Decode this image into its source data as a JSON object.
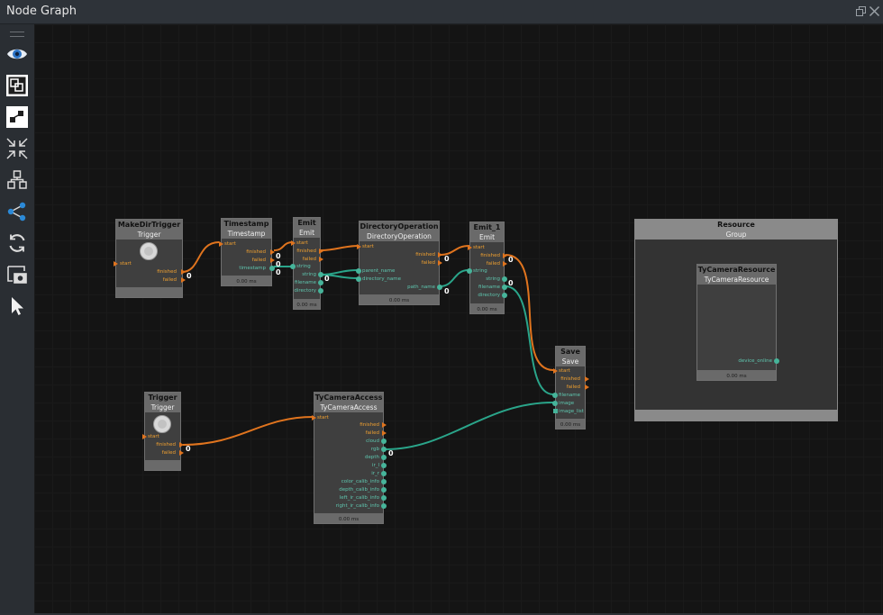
{
  "window": {
    "title": "Node Graph",
    "restore_icon": "restore-icon",
    "close_icon": "close-icon"
  },
  "toolbar": [
    "eye-icon",
    "frame-icon",
    "layout-icon",
    "collapse-icon",
    "tree-icon",
    "share-icon",
    "refresh-icon",
    "camera-icon",
    "cursor-icon"
  ],
  "colors": {
    "exec": "#e0741e",
    "data": "#2aa58a",
    "header": "#6a6a6a",
    "canvas": "#141414"
  },
  "nodes": {
    "makedir": {
      "title": "MakeDirTrigger",
      "type": "Trigger",
      "in": [
        "start"
      ],
      "out": [
        "finished",
        "failed"
      ],
      "counts": [
        "0"
      ]
    },
    "timestamp": {
      "title": "Timestamp",
      "type": "Timestamp",
      "in": [
        "start"
      ],
      "out": [
        "finished",
        "failed",
        "timestamp"
      ],
      "counts": [
        "0",
        "0",
        "0"
      ],
      "time": "0.00 ms"
    },
    "emit": {
      "title": "Emit",
      "type": "Emit",
      "in": [
        "start",
        "string"
      ],
      "out": [
        "finished",
        "failed",
        "string",
        "filename",
        "directory"
      ],
      "counts": [
        "0"
      ],
      "time": "0.00 ms"
    },
    "dirop": {
      "title": "DirectoryOperation",
      "type": "DirectoryOperation",
      "in": [
        "start",
        "parent_name",
        "directory_name"
      ],
      "out": [
        "finished",
        "failed",
        "path_name"
      ],
      "counts": [
        "0",
        "0"
      ],
      "time": "0.00 ms"
    },
    "emit1": {
      "title": "Emit_1",
      "type": "Emit",
      "in": [
        "start",
        "string"
      ],
      "out": [
        "finished",
        "failed",
        "string",
        "filename",
        "directory"
      ],
      "counts": [
        "0",
        "0"
      ],
      "time": "0.00 ms"
    },
    "save": {
      "title": "Save",
      "type": "Save",
      "in": [
        "start",
        "filename",
        "image",
        "image_list"
      ],
      "out": [
        "finished",
        "failed"
      ],
      "time": "0.00 ms"
    },
    "trigger": {
      "title": "Trigger",
      "type": "Trigger",
      "in": [
        "start"
      ],
      "out": [
        "finished",
        "failed"
      ],
      "counts": [
        "0"
      ]
    },
    "tycam": {
      "title": "TyCameraAccess",
      "type": "TyCameraAccess",
      "in": [
        "start"
      ],
      "out": [
        "finished",
        "failed",
        "cloud",
        "rgb",
        "depth",
        "ir_l",
        "ir_r",
        "color_calib_info",
        "depth_calib_info",
        "left_ir_calib_info",
        "right_ir_calib_info"
      ],
      "counts": [
        "0"
      ],
      "time": "0.00 ms"
    },
    "tyres": {
      "title": "TyCameraResource",
      "type": "TyCameraResource",
      "out": [
        "device_online"
      ],
      "time": "0.00 ms"
    }
  },
  "group": {
    "title": "Resource",
    "type": "Group"
  }
}
